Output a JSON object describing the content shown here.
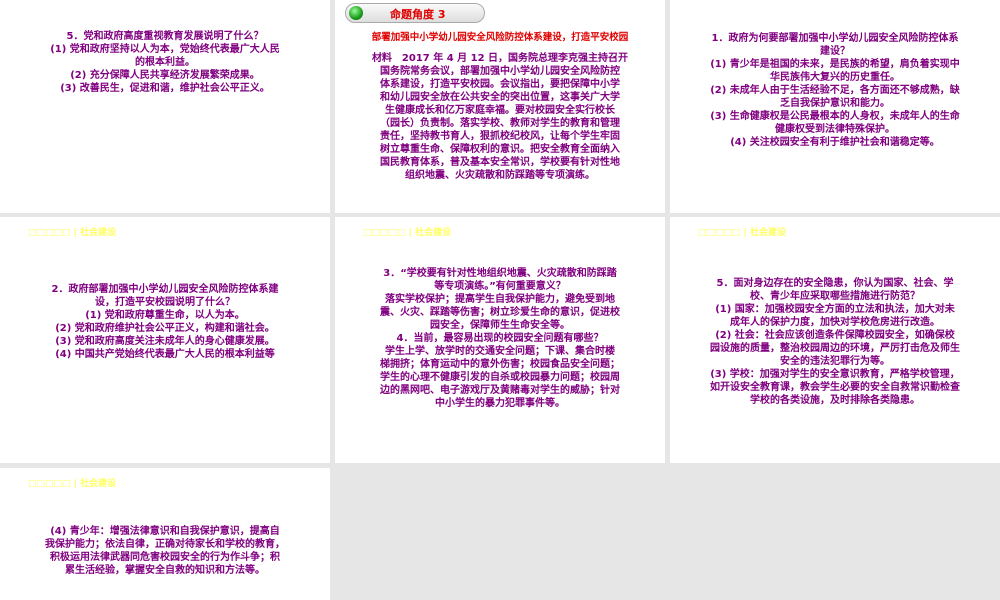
{
  "slides": [
    {
      "text": "5．党和政府高度重视教育发展说明了什么？\n(1) 党和政府坚持以人为本，党始终代表最广大人民\n的根本利益。\n(2) 充分保障人民共享经济发展繁荣成果。\n(3) 改善民生，促进和谐，维护社会公平正义。"
    },
    {
      "badge": "命题角度 3",
      "title": "部署加强中小学幼儿园安全风险防控体系建设，打造平安校园",
      "text": "材料　2017 年 4 月 12 日，国务院总理李克强主持召开\n国务院常务会议，部署加强中小学幼儿园安全风险防控\n体系建设，打造平安校园。会议指出，要把保障中小学\n和幼儿园安全放在公共安全的突出位置，这事关广大学\n生健康成长和亿万家庭幸福。要对校园安全实行校长\n（园长）负责制。落实学校、教师对学生的教育和管理\n责任，坚持教书育人，狠抓校纪校风，让每个学生牢固\n树立尊重生命、保障权利的意识。把安全教育全面纳入\n国民教育体系，普及基本安全常识，学校要有针对性地\n组织地震、火灾疏散和防踩踏等专项演练。"
    },
    {
      "text": "1．政府为何要部署加强中小学幼儿园安全风险防控体系\n建设？\n(1) 青少年是祖国的未来，是民族的希望，肩负着实现中\n华民族伟大复兴的历史重任。\n(2) 未成年人由于生活经验不足，各方面还不够成熟，缺\n乏自我保护意识和能力。\n(3) 生命健康权是公民最根本的人身权，未成年人的生命\n健康权受到法律特殊保护。\n(4) 关注校园安全有利于维护社会和谐稳定等。"
    },
    {
      "header": "□□□□□ | 社会建设",
      "text": "2．政府部署加强中小学幼儿园安全风险防控体系建\n设，打造平安校园说明了什么？\n(1) 党和政府尊重生命，以人为本。\n(2) 党和政府维护社会公平正义，构建和谐社会。\n(3) 党和政府高度关注未成年人的身心健康发展。\n(4) 中国共产党始终代表最广大人民的根本利益等"
    },
    {
      "header": "□□□□□ | 社会建设",
      "text": "3．“学校要有针对性地组织地震、火灾疏散和防踩踏\n等专项演练。”有何重要意义？\n落实学校保护；提高学生自我保护能力，避免受到地\n震、火灾、踩踏等伤害；树立珍爱生命的意识，促进校\n园安全，保障师生生命安全等。\n4．当前，最容易出现的校园安全问题有哪些？\n学生上学、放学时的交通安全问题；下课、集合时楼\n梯拥挤；体育运动中的意外伤害；校园食品安全问题；\n学生的心理不健康引发的自杀或校园暴力问题；校园周\n边的黑网吧、电子游戏厅及黄赌毒对学生的威胁；针对\n中小学生的暴力犯罪事件等。"
    },
    {
      "header": "□□□□□ | 社会建设",
      "text": "5．面对身边存在的安全隐患，你认为国家、社会、学\n校、青少年应采取哪些措施进行防范？\n(1) 国家：加强校园安全方面的立法和执法，加大对未\n成年人的保护力度，加快对学校危房进行改造。\n(2) 社会：社会应该创造条件保障校园安全，如确保校\n园设施的质量，整治校园周边的环境，严厉打击危及师生\n安全的违法犯罪行为等。\n(3) 学校：加强对学生的安全意识教育，严格学校管理，\n如开设安全教育课，教会学生必要的安全自救常识勤检查\n学校的各类设施，及时排除各类隐患。"
    },
    {
      "header": "□□□□□ | 社会建设",
      "text": "(4) 青少年：增强法律意识和自我保护意识，提高自\n我保护能力；依法自律，正确对待家长和学校的教育，\n积极运用法律武器同危害校园安全的行为作斗争；积\n累生活经验，掌握安全自救的知识和方法等。"
    }
  ]
}
